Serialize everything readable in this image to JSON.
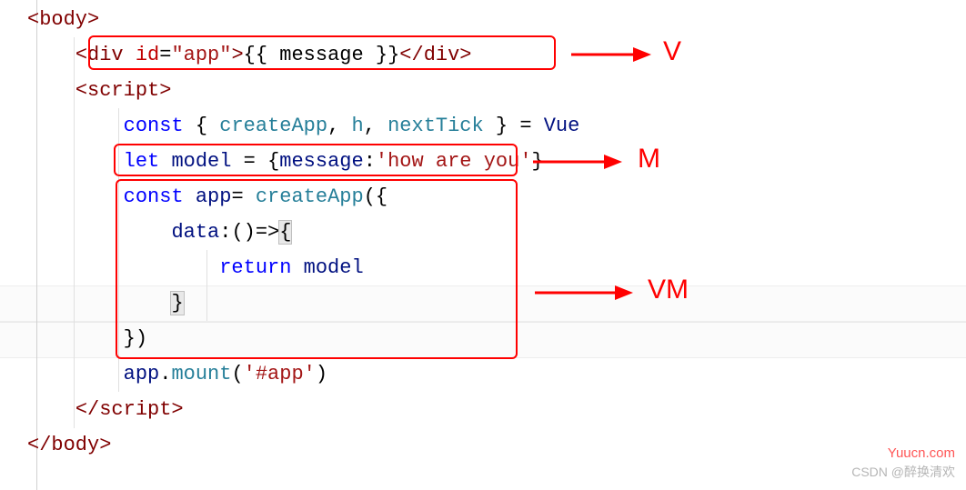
{
  "code": {
    "l1_open": "<body>",
    "l2_div_open": "<div",
    "l2_attr_name": " id",
    "l2_eq": "=",
    "l2_attr_val": "\"app\"",
    "l2_close1": ">",
    "l2_text": "{{ message }}",
    "l2_close2": "</div>",
    "l3_script": "<script>",
    "l4_const": "const",
    "l4_dest_open": " { ",
    "l4_createApp": "createApp",
    "l4_c1": ", ",
    "l4_h": "h",
    "l4_c2": ", ",
    "l4_nextTick": "nextTick",
    "l4_dest_close": " } ",
    "l4_eq": "= ",
    "l4_Vue": "Vue",
    "l5_let": "let",
    "l5_sp": " ",
    "l5_model": "model",
    "l5_eq": " = ",
    "l5_obj_open": "{",
    "l5_key": "message",
    "l5_colon": ":",
    "l5_val": "'how are you'",
    "l5_obj_close": "}",
    "l6_const": "const",
    "l6_sp": " ",
    "l6_app": "app",
    "l6_eq": "= ",
    "l6_create": "createApp",
    "l6_paren": "(",
    "l6_brace": "{",
    "l7_data": "data",
    "l7_colon": ":",
    "l7_arrow": "()=>",
    "l7_brace": "{",
    "l8_return": "return",
    "l8_sp": " ",
    "l8_model": "model",
    "l9_brace": "}",
    "l10_close": "})",
    "l11_app": "app",
    "l11_dot": ".",
    "l11_mount": "mount",
    "l11_paren_open": "(",
    "l11_str": "'#app'",
    "l11_paren_close": ")",
    "l12_script_close": "</script>",
    "l13_body_close": "</body>"
  },
  "annotations": {
    "v_label": "V",
    "m_label": "M",
    "vm_label": "VM"
  },
  "watermarks": {
    "site": "Yuucn.com",
    "csdn": "CSDN @醉换清欢"
  }
}
